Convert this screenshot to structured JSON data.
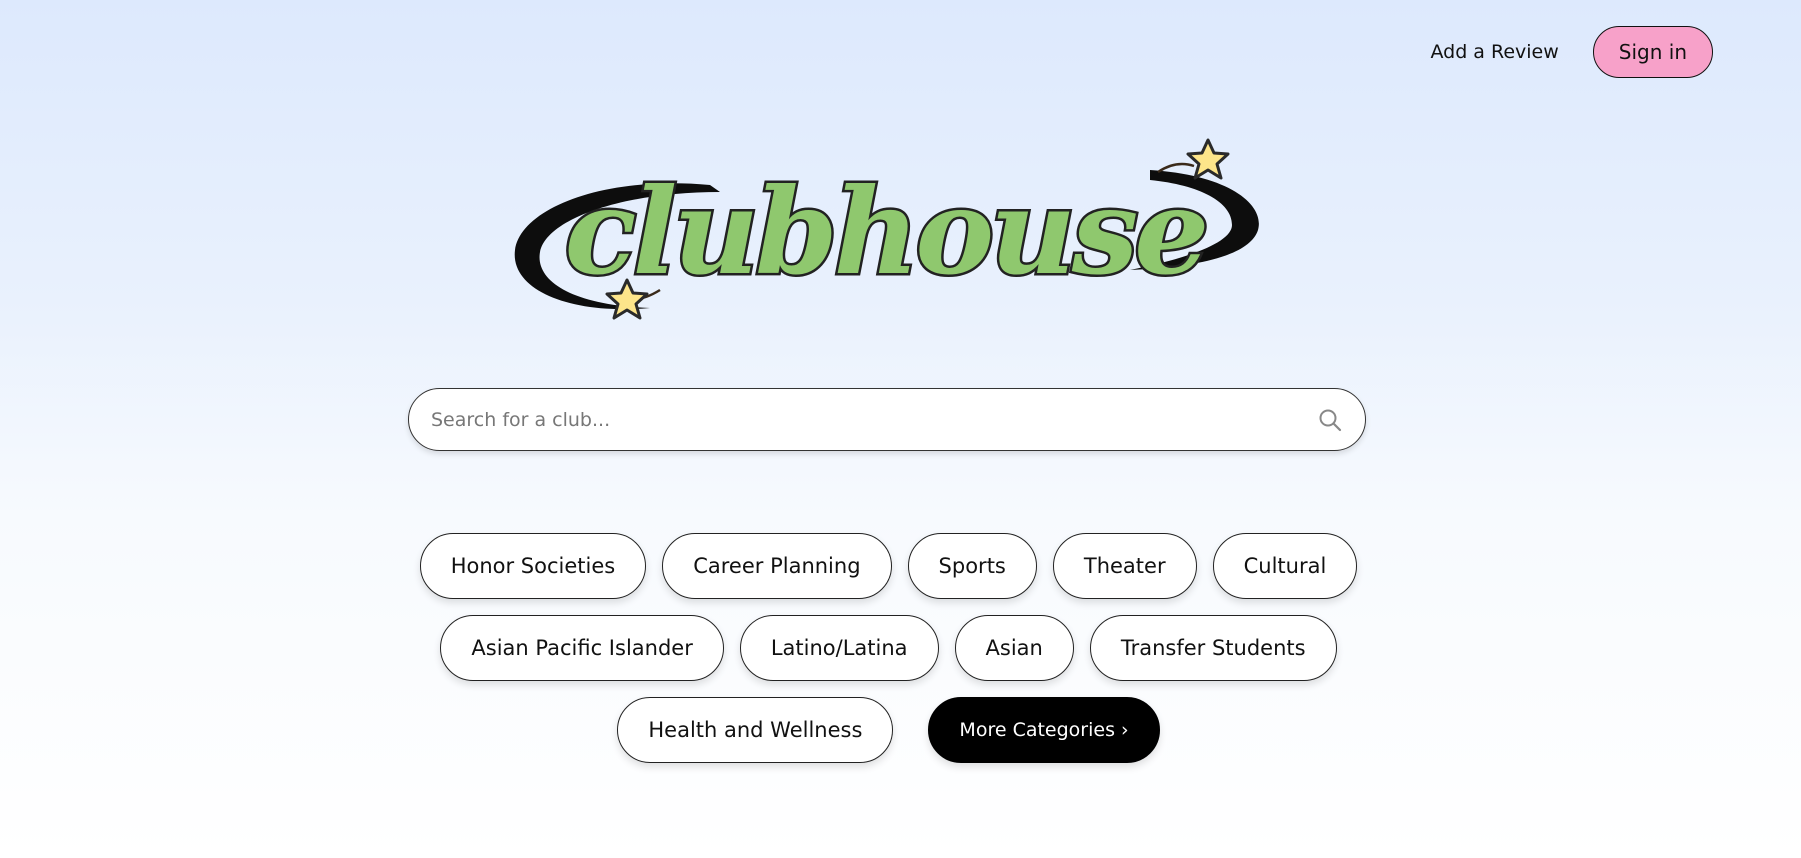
{
  "nav": {
    "add_review": "Add a Review",
    "sign_in": "Sign in"
  },
  "logo": {
    "text": "clubhouse"
  },
  "search": {
    "placeholder": "Search for a club..."
  },
  "categories": {
    "row1": [
      "Honor Societies",
      "Career Planning",
      "Sports",
      "Theater",
      "Cultural"
    ],
    "row2": [
      "Asian Pacific Islander",
      "Latino/Latina",
      "Asian",
      "Transfer Students"
    ],
    "row3": [
      "Health and Wellness"
    ],
    "more": "More Categories ›"
  },
  "colors": {
    "logo_green": "#8fc86e",
    "sign_in_bg": "#f7a1c9",
    "star_yellow": "#fde58a"
  },
  "icons": {
    "search": "search-icon",
    "star": "star-icon"
  }
}
